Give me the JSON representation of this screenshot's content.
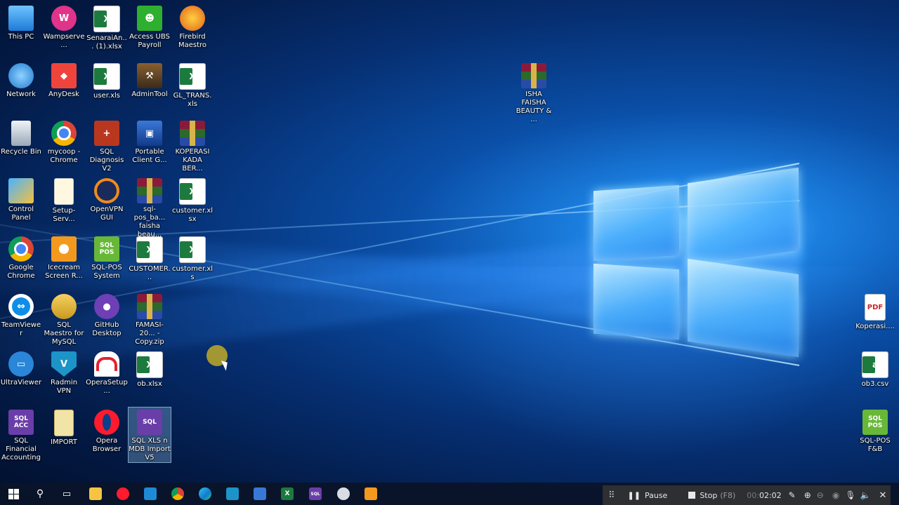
{
  "desktop_icons": [
    {
      "label": "This PC"
    },
    {
      "label": "Wampserve..."
    },
    {
      "label": "SenaraiAn... (1).xlsx"
    },
    {
      "label": "Access UBS Payroll"
    },
    {
      "label": "Firebird Maestro"
    },
    {
      "label": "Network"
    },
    {
      "label": "AnyDesk"
    },
    {
      "label": "user.xls"
    },
    {
      "label": "AdminTool"
    },
    {
      "label": "GL_TRANS.xls"
    },
    {
      "label": "Recycle Bin"
    },
    {
      "label": "mycoop - Chrome"
    },
    {
      "label": "SQL Diagnosis V2"
    },
    {
      "label": "Portable Client G..."
    },
    {
      "label": "KOPERASI KADA BER..."
    },
    {
      "label": "Control Panel"
    },
    {
      "label": "Setup-Serv..."
    },
    {
      "label": "OpenVPN GUI"
    },
    {
      "label": "sql-pos_ba... faisha beau..."
    },
    {
      "label": "customer.xlsx"
    },
    {
      "label": "Google Chrome"
    },
    {
      "label": "Icecream Screen R..."
    },
    {
      "label": "SQL-POS System"
    },
    {
      "label": "CUSTOMER..."
    },
    {
      "label": "customer.xls"
    },
    {
      "label": "TeamViewer"
    },
    {
      "label": "SQL Maestro for MySQL"
    },
    {
      "label": "GitHub Desktop"
    },
    {
      "label": "FAMASI-20... - Copy.zip"
    },
    {
      "label": "UltraViewer"
    },
    {
      "label": "Radmin VPN"
    },
    {
      "label": "OperaSetup..."
    },
    {
      "label": "ob.xlsx"
    },
    {
      "label": "SQL Financial Accounting"
    },
    {
      "label": "IMPORT"
    },
    {
      "label": "Opera Browser"
    },
    {
      "label": "SQL XLS n MDB Import V5"
    },
    {
      "label": "ISHA FAISHA BEAUTY & ..."
    },
    {
      "label": "Koperasi...."
    },
    {
      "label": "ob3.csv"
    },
    {
      "label": "SQL-POS F&B"
    }
  ],
  "icon_glyphs": {
    "sql": "SQL",
    "sql_acc": "SQL ACC",
    "sql_pos": "SQL POS",
    "xl": "X",
    "xl_a": "a"
  },
  "recorder": {
    "pause_label": "Pause",
    "stop_label": "Stop",
    "stop_shortcut": "(F8)",
    "time_dim": "00:",
    "time": "02:02"
  },
  "colors": {
    "accent": "#1b7fe0",
    "taskbar": "#0a1428"
  }
}
